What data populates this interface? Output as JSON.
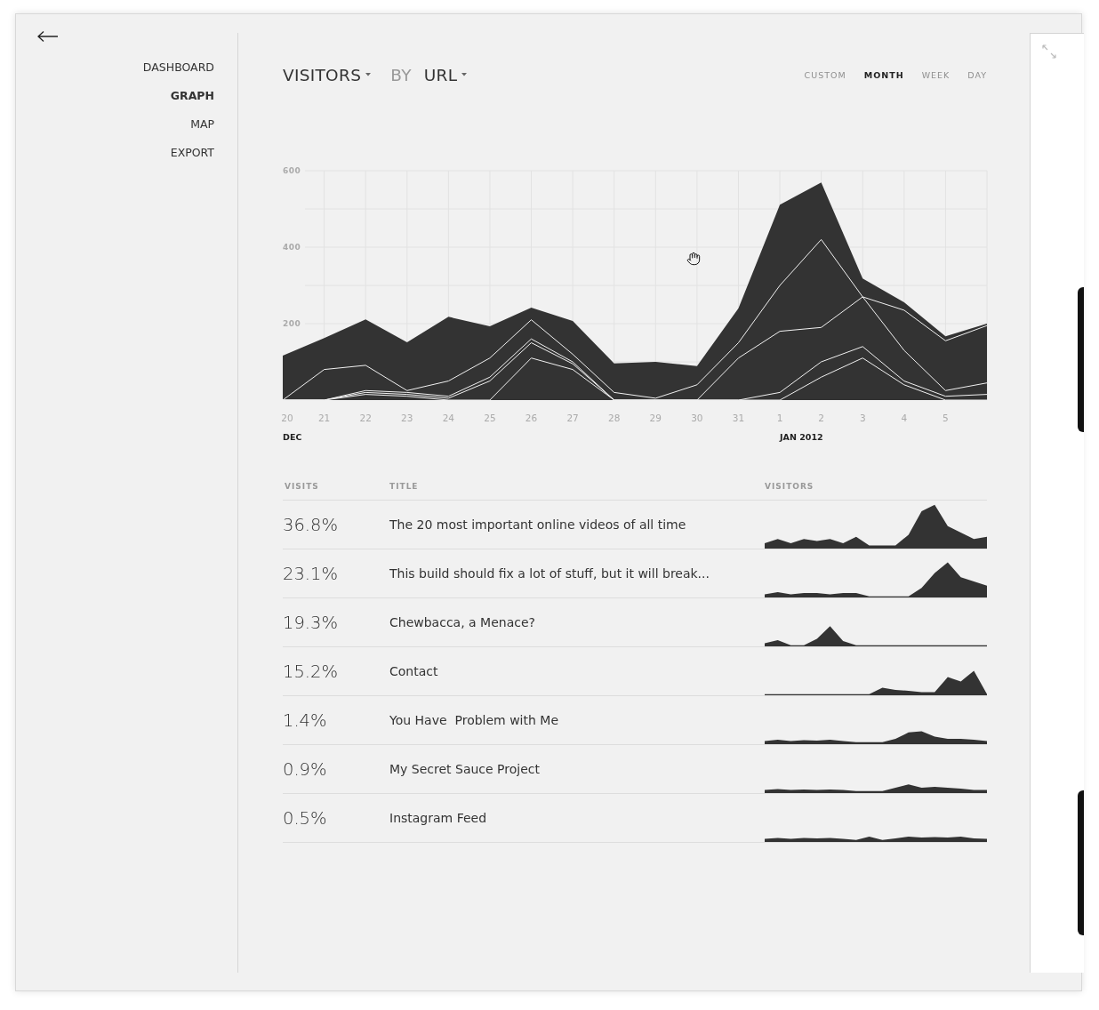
{
  "nav": [
    {
      "label": "DASHBOARD",
      "selected": false
    },
    {
      "label": "GRAPH",
      "selected": true
    },
    {
      "label": "MAP",
      "selected": false
    },
    {
      "label": "EXPORT",
      "selected": false
    }
  ],
  "header": {
    "metric": "VISITORS",
    "by": "BY",
    "dimension": "URL"
  },
  "ranges": [
    {
      "label": "CUSTOM",
      "selected": false
    },
    {
      "label": "MONTH",
      "selected": true
    },
    {
      "label": "WEEK",
      "selected": false
    },
    {
      "label": "DAY",
      "selected": false
    }
  ],
  "chart": {
    "chart_data": {
      "type": "area",
      "stacked": false,
      "categories": [
        "20",
        "21",
        "22",
        "23",
        "24",
        "25",
        "26",
        "27",
        "28",
        "29",
        "30",
        "31",
        "1",
        "2",
        "3",
        "4",
        "5",
        null
      ],
      "series": [
        {
          "type": "area",
          "values": [
            116,
            162,
            211,
            151,
            218,
            193,
            242,
            207,
            96,
            100,
            89,
            240,
            511,
            569,
            318,
            256,
            167,
            200
          ]
        },
        {
          "type": "line",
          "values": [
            0,
            80,
            91,
            25,
            50,
            110,
            210,
            120,
            20,
            5,
            40,
            150,
            300,
            420,
            270,
            235,
            155,
            195
          ]
        },
        {
          "type": "line",
          "values": [
            0,
            0,
            25,
            20,
            10,
            60,
            160,
            100,
            0,
            0,
            0,
            110,
            180,
            190,
            270,
            130,
            25,
            45
          ]
        },
        {
          "type": "line",
          "values": [
            0,
            0,
            20,
            15,
            5,
            50,
            150,
            95,
            0,
            0,
            0,
            0,
            20,
            100,
            140,
            50,
            10,
            15
          ]
        },
        {
          "type": "line",
          "values": [
            0,
            0,
            15,
            10,
            0,
            0,
            110,
            80,
            0,
            0,
            0,
            0,
            0,
            60,
            110,
            40,
            0,
            0
          ]
        }
      ],
      "ylim": [
        0,
        600
      ],
      "grid": true,
      "yticks": [
        200,
        400,
        600
      ],
      "annotations": [
        "DEC",
        "JAN 2012"
      ]
    }
  },
  "table": {
    "columns": [
      "VISITS",
      "TITLE",
      "VISITORS"
    ],
    "rows": [
      {
        "visits": "36.8%",
        "title": "The 20 most important online videos of all time"
      },
      {
        "visits": "23.1%",
        "title": "This build should fix a lot of stuff, but it will break..."
      },
      {
        "visits": "19.3%",
        "title": "Chewbacca, a Menace?"
      },
      {
        "visits": "15.2%",
        "title": "Contact"
      },
      {
        "visits": "1.4%",
        "title": "You Have  Problem with Me"
      },
      {
        "visits": "0.9%",
        "title": "My Secret Sauce Project"
      },
      {
        "visits": "0.5%",
        "title": "Instagram Feed"
      }
    ]
  }
}
